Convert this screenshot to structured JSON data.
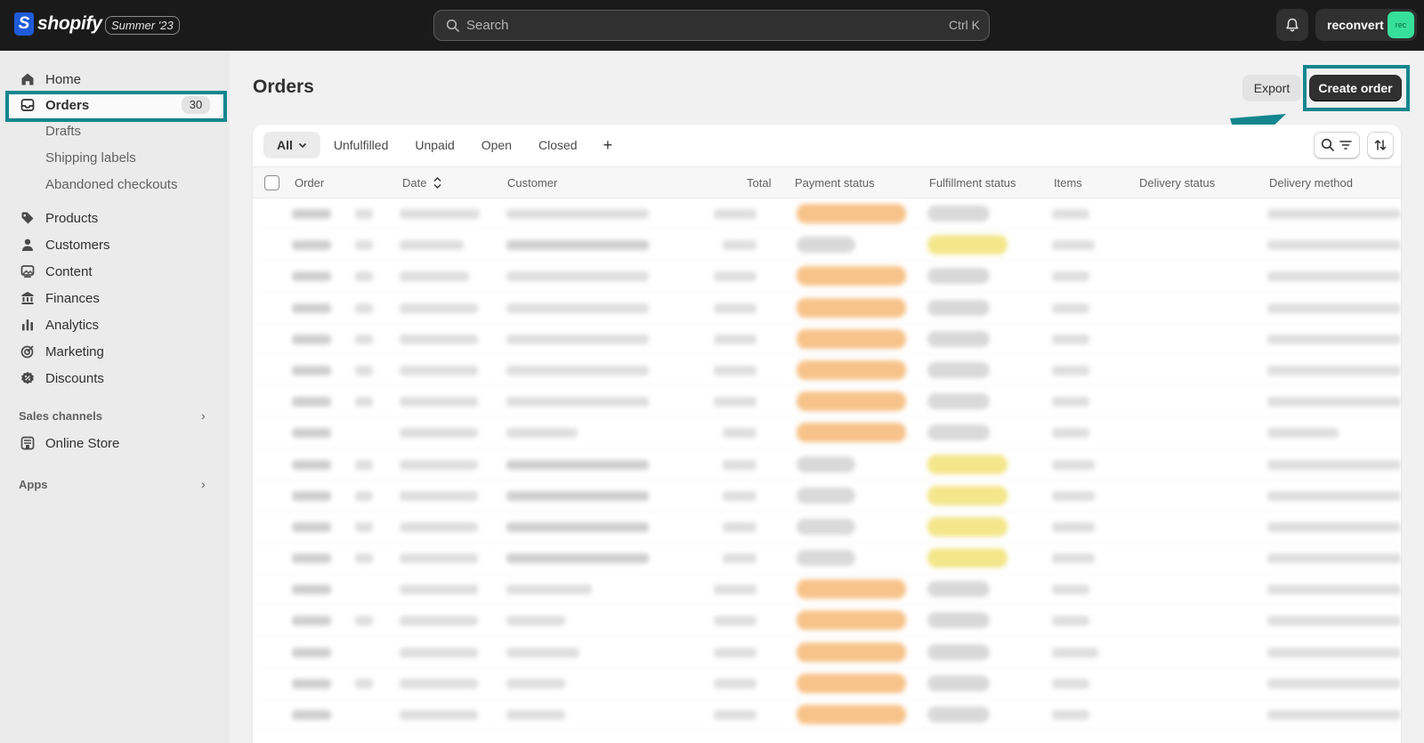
{
  "topbar": {
    "brand": "shopify",
    "brand_mark": "S",
    "edition": "Summer '23",
    "search_placeholder": "Search",
    "search_shortcut": "Ctrl K",
    "account_name": "reconvert",
    "avatar_text": "rec"
  },
  "sidebar": {
    "items": [
      {
        "label": "Home",
        "icon": "home-icon"
      },
      {
        "label": "Orders",
        "icon": "inbox-icon",
        "badge": "30"
      },
      {
        "label": "Drafts"
      },
      {
        "label": "Shipping labels"
      },
      {
        "label": "Abandoned checkouts"
      },
      {
        "label": "Products",
        "icon": "tag-icon"
      },
      {
        "label": "Customers",
        "icon": "person-icon"
      },
      {
        "label": "Content",
        "icon": "image-icon"
      },
      {
        "label": "Finances",
        "icon": "bank-icon"
      },
      {
        "label": "Analytics",
        "icon": "bar-chart-icon"
      },
      {
        "label": "Marketing",
        "icon": "target-icon"
      },
      {
        "label": "Discounts",
        "icon": "discount-icon"
      }
    ],
    "sales_channels_title": "Sales channels",
    "online_store": "Online Store",
    "apps_title": "Apps"
  },
  "main": {
    "title": "Orders",
    "export_label": "Export",
    "create_label": "Create order",
    "tabs": [
      "All",
      "Unfulfilled",
      "Unpaid",
      "Open",
      "Closed"
    ],
    "add_tab": "+",
    "columns": [
      "Order",
      "Date",
      "Customer",
      "Total",
      "Payment status",
      "Fulfillment status",
      "Items",
      "Delivery status",
      "Delivery method"
    ]
  },
  "colors": {
    "highlight": "#14868f",
    "payment_pending": "#f7c38a",
    "fulfillment_unfulfilled": "#f4e68a"
  }
}
